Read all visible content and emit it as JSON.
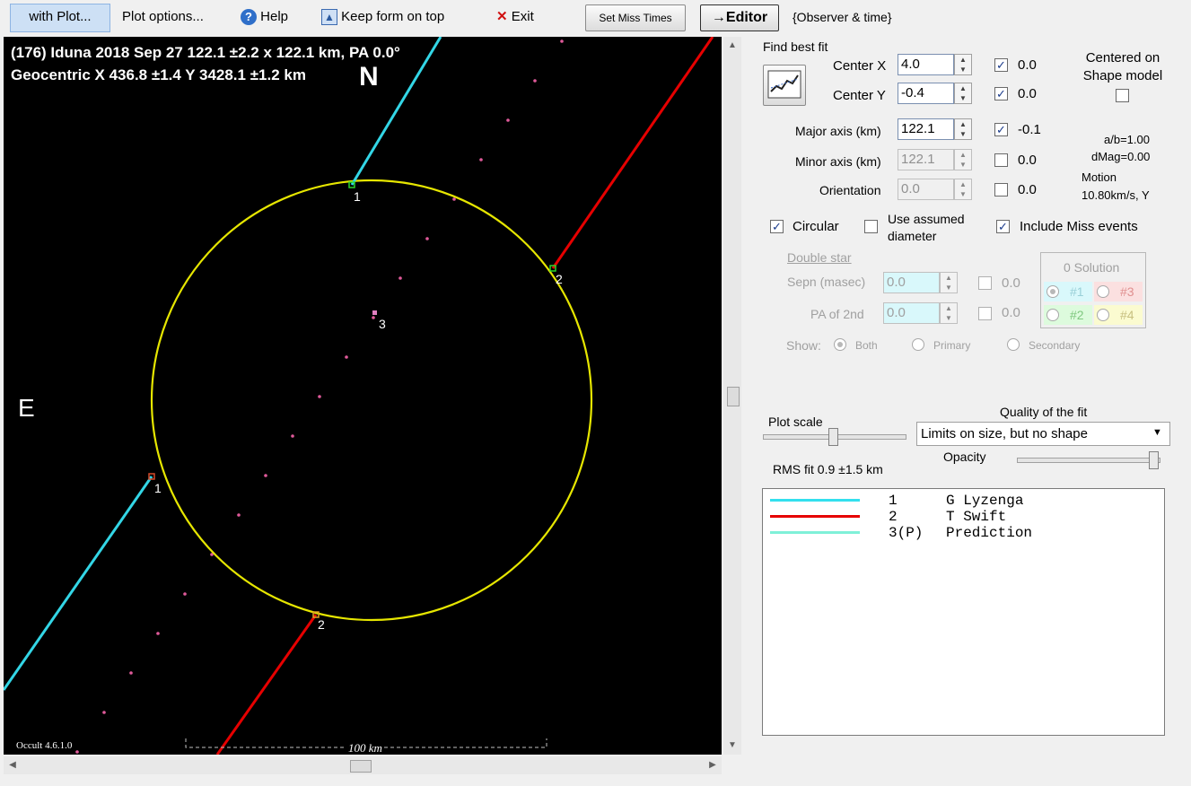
{
  "menu": {
    "with_plot": "with Plot...",
    "plot_options": "Plot options...",
    "help": "Help",
    "keep_form_on_top": "Keep form on top",
    "exit": "Exit",
    "set_miss_times": "Set Miss Times",
    "editor": "→Editor",
    "observer_time": "{Observer & time}"
  },
  "plot": {
    "title_line1": "(176) Iduna  2018 Sep 27   122.1 ±2.2 x 122.1 km,  PA 0.0°",
    "title_line2": "Geocentric  X  436.8 ±1.4  Y 3428.1 ±1.2 km",
    "north_label": "N",
    "east_label": "E",
    "chord_label_1a": "1",
    "chord_label_1b": "1",
    "chord_label_2a": "2",
    "chord_label_2b": "2",
    "center_label": "3",
    "version": "Occult 4.6.1.0",
    "scale_label": "100 km",
    "colors": {
      "ellipse": "#e6e600",
      "chord1": "#33d6e6",
      "chord2": "#e60000",
      "prediction": "#e05a9a"
    }
  },
  "fit": {
    "find_best_fit": "Find best fit",
    "center_x_label": "Center X",
    "center_x_value": "4.0",
    "center_x_delta": "0.0",
    "center_y_label": "Center Y",
    "center_y_value": "-0.4",
    "center_y_delta": "0.0",
    "major_label": "Major axis (km)",
    "major_value": "122.1",
    "major_delta": "-0.1",
    "minor_label": "Minor axis (km)",
    "minor_value": "122.1",
    "minor_delta": "0.0",
    "orientation_label": "Orientation",
    "orientation_value": "0.0",
    "orientation_delta": "0.0",
    "centered_on_shape": "Centered on Shape model",
    "ab_ratio": "a/b=1.00",
    "dmag": "dMag=0.00",
    "motion_label": "Motion",
    "motion_value": "10.80km/s, Y",
    "circular": "Circular",
    "use_assumed_diameter": "Use assumed diameter",
    "include_miss_events": "Include Miss events"
  },
  "double_star": {
    "title": "Double star",
    "sepn_label": "Sepn (masec)",
    "sepn_value": "0.0",
    "sepn_delta": "0.0",
    "pa_label": "PA of 2nd",
    "pa_value": "0.0",
    "pa_delta": "0.0",
    "show_label": "Show:",
    "show_both": "Both",
    "show_primary": "Primary",
    "show_secondary": "Secondary",
    "solution_title": "0 Solution",
    "sol1": "#1",
    "sol2": "#2",
    "sol3": "#3",
    "sol4": "#4"
  },
  "scale": {
    "plot_scale": "Plot scale",
    "quality_label": "Quality of the fit",
    "quality_value": "Limits on size, but no shape",
    "opacity": "Opacity",
    "rms_fit": "RMS fit  0.9 ±1.5 km",
    "opacity_level": 1.0
  },
  "legend": {
    "rows": [
      {
        "num": "1",
        "name": "G Lyzenga",
        "color": "#33e0ee"
      },
      {
        "num": "2",
        "name": "T Swift",
        "color": "#e60000"
      },
      {
        "num": "3(P)",
        "name": "Prediction",
        "color": "#7ff0d8"
      }
    ]
  }
}
